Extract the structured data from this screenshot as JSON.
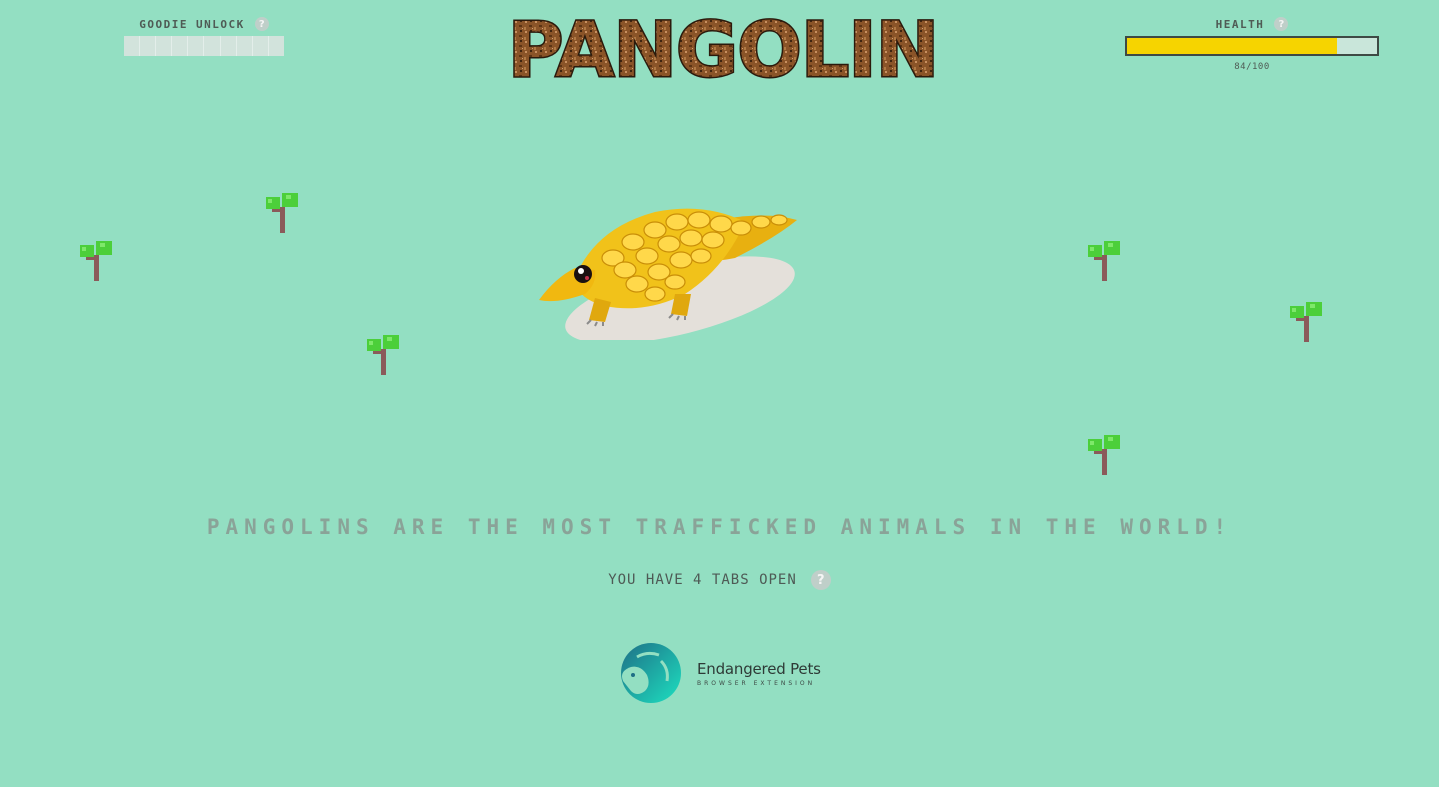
{
  "goodie": {
    "label": "Goodie Unlock",
    "help": "?",
    "progress_segments_total": 10,
    "progress_segments_filled": 0
  },
  "title": {
    "text": "PANGOLIN"
  },
  "health": {
    "label": "Health",
    "help": "?",
    "value": 84,
    "max": 100,
    "text": "84/100",
    "fill_color": "#f6d400"
  },
  "pet": {
    "icon": "pangolin-sprite"
  },
  "trees": {
    "icon": "tree-icon",
    "count": 6
  },
  "fact": {
    "text": "Pangolins are the most trafficked animals in the world!"
  },
  "tabs": {
    "text": "You have 4 tabs open",
    "help": "?"
  },
  "brand": {
    "name": "Endangered Pets",
    "subtitle": "BROWSER EXTENSION",
    "icon": "endangered-pets-logo"
  },
  "colors": {
    "background": "#93dfc2",
    "title_brown": "#7a4a22",
    "pet_gold": "#f3c21a"
  }
}
